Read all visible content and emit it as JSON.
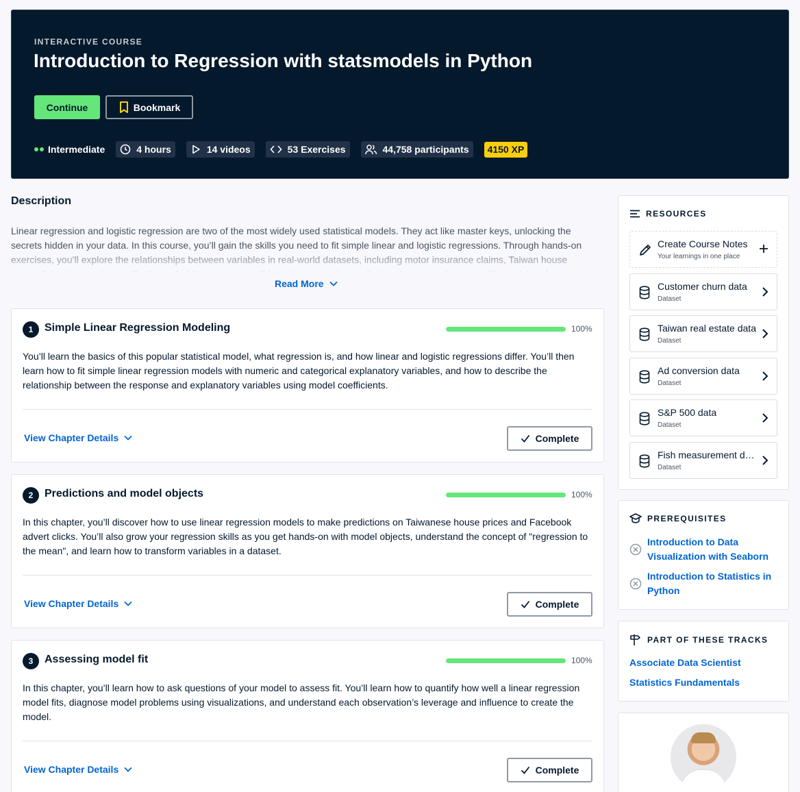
{
  "hero": {
    "eyebrow": "INTERACTIVE COURSE",
    "title": "Introduction to Regression with statsmodels in Python",
    "continue_label": "Continue",
    "bookmark_label": "Bookmark",
    "level": "Intermediate",
    "hours": "4 hours",
    "videos": "14 videos",
    "exercises": "53 Exercises",
    "participants": "44,758 participants",
    "xp": "4150 XP",
    "accent": "#65e67a",
    "xp_color": "#fcce0d"
  },
  "description": {
    "heading": "Description",
    "text": "Linear regression and logistic regression are two of the most widely used statistical models. They act like master keys, unlocking the secrets hidden in your data. In this course, you’ll gain the skills you need to fit simple linear and logistic regressions. Through hands-on exercises, you’ll explore the relationships between variables in real-world datasets, including motor insurance claims, Taiwan house prices, fish sizes, and more. By the end of this course, you’ll know how to make predictions from your data, quantify model performance, and diagnose problems with model fit.",
    "read_more": "Read More"
  },
  "chapters": [
    {
      "num": "1",
      "title": "Simple Linear Regression Modeling",
      "progress": "100%",
      "text": "You’ll learn the basics of this popular statistical model, what regression is, and how linear and logistic regressions differ. You’ll then learn how to fit simple linear regression models with numeric and categorical explanatory variables, and how to describe the relationship between the response and explanatory variables using model coefficients.",
      "details": "View Chapter Details",
      "complete": "Complete"
    },
    {
      "num": "2",
      "title": "Predictions and model objects",
      "progress": "100%",
      "text": "In this chapter, you’ll discover how to use linear regression models to make predictions on Taiwanese house prices and Facebook advert clicks. You’ll also grow your regression skills as you get hands-on with model objects, understand the concept of \"regression to the mean\", and learn how to transform variables in a dataset.",
      "details": "View Chapter Details",
      "complete": "Complete"
    },
    {
      "num": "3",
      "title": "Assessing model fit",
      "progress": "100%",
      "text": "In this chapter, you’ll learn how to ask questions of your model to assess fit. You’ll learn how to quantify how well a linear regression model fits, diagnose model problems using visualizations, and understand each observation’s leverage and influence to create the model.",
      "details": "View Chapter Details",
      "complete": "Complete"
    }
  ],
  "resources": {
    "heading": "RESOURCES",
    "notes_title": "Create Course Notes",
    "notes_sub": "Your learnings in one place",
    "items": [
      {
        "title": "Customer churn data",
        "sub": "Dataset"
      },
      {
        "title": "Taiwan real estate data",
        "sub": "Dataset"
      },
      {
        "title": "Ad conversion data",
        "sub": "Dataset"
      },
      {
        "title": "S&P 500 data",
        "sub": "Dataset"
      },
      {
        "title": "Fish measurement data",
        "sub": "Dataset"
      }
    ]
  },
  "prerequisites": {
    "heading": "PREREQUISITES",
    "items": [
      "Introduction to Data Visualization with Seaborn",
      "Introduction to Statistics in Python"
    ]
  },
  "tracks": {
    "heading": "PART OF THESE TRACKS",
    "items": [
      "Associate Data Scientist",
      "Statistics Fundamentals"
    ]
  }
}
